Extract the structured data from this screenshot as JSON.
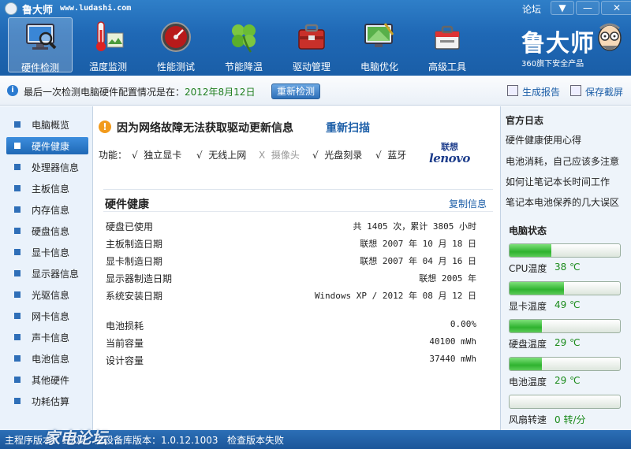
{
  "app": {
    "title": "鲁大师",
    "url": "www.ludashi.com",
    "forum": "论坛",
    "brand_name": "鲁大师",
    "brand_sub": "360旗下安全产品"
  },
  "window_controls": {
    "menu": "▼",
    "minimize": "—",
    "close": "✕"
  },
  "nav": [
    {
      "label": "硬件检测",
      "icon": "monitor-magnifier-icon",
      "active": true
    },
    {
      "label": "温度监测",
      "icon": "thermometer-icon",
      "active": false
    },
    {
      "label": "性能测试",
      "icon": "speedometer-icon",
      "active": false
    },
    {
      "label": "节能降温",
      "icon": "clover-icon",
      "active": false
    },
    {
      "label": "驱动管理",
      "icon": "toolbox-icon",
      "active": false
    },
    {
      "label": "电脑优化",
      "icon": "monitor-sweep-icon",
      "active": false
    },
    {
      "label": "高级工具",
      "icon": "toolkit-icon",
      "active": false
    }
  ],
  "infobar": {
    "text": "最后一次检测电脑硬件配置情况是在：",
    "date": "2012年8月12日",
    "rescan": "重新检测",
    "report": "生成报告",
    "screenshot": "保存截屏"
  },
  "sidebar": [
    {
      "label": "电脑概览",
      "active": false
    },
    {
      "label": "硬件健康",
      "active": true
    },
    {
      "label": "处理器信息",
      "active": false
    },
    {
      "label": "主板信息",
      "active": false
    },
    {
      "label": "内存信息",
      "active": false
    },
    {
      "label": "硬盘信息",
      "active": false
    },
    {
      "label": "显卡信息",
      "active": false
    },
    {
      "label": "显示器信息",
      "active": false
    },
    {
      "label": "光驱信息",
      "active": false
    },
    {
      "label": "网卡信息",
      "active": false
    },
    {
      "label": "声卡信息",
      "active": false
    },
    {
      "label": "电池信息",
      "active": false
    },
    {
      "label": "其他硬件",
      "active": false
    },
    {
      "label": "功耗估算",
      "active": false
    }
  ],
  "main": {
    "warning": "因为网络故障无法获取驱动更新信息",
    "rescan_link": "重新扫描",
    "features_label": "功能：",
    "features": [
      {
        "mark": "√",
        "label": "独立显卡",
        "available": true
      },
      {
        "mark": "√",
        "label": "无线上网",
        "available": true
      },
      {
        "mark": "X",
        "label": "摄像头",
        "available": false
      },
      {
        "mark": "√",
        "label": "光盘刻录",
        "available": true
      },
      {
        "mark": "√",
        "label": "蓝牙",
        "available": true
      }
    ],
    "vendor_cn": "联想",
    "vendor_en": "lenovo",
    "section_title": "硬件健康",
    "copy_link": "复制信息",
    "rows": [
      {
        "label": "硬盘已使用",
        "value": "共 1405 次，累计 3805 小时"
      },
      {
        "label": "主板制造日期",
        "value": "联想 2007 年 10 月 18 日"
      },
      {
        "label": "显卡制造日期",
        "value": "联想 2007 年 04 月 16 日"
      },
      {
        "label": "显示器制造日期",
        "value": "联想 2005 年"
      },
      {
        "label": "系统安装日期",
        "value": "Windows XP / 2012 年 08 月 12 日"
      }
    ],
    "battery_rows": [
      {
        "label": "电池损耗",
        "value": "0.00%"
      },
      {
        "label": "当前容量",
        "value": "40100 mWh"
      },
      {
        "label": "设计容量",
        "value": "37440 mWh"
      }
    ]
  },
  "right_panel": {
    "blog_title": "官方日志",
    "blog_links": [
      "硬件健康使用心得",
      "电池消耗，自己应该多注意",
      "如何让笔记本长时间工作",
      "笔记本电池保养的几大误区"
    ],
    "status_title": "电脑状态",
    "meters": [
      {
        "label": "CPU温度",
        "value": "38 ℃",
        "level": 0.38
      },
      {
        "label": "显卡温度",
        "value": "49 ℃",
        "level": 0.49
      },
      {
        "label": "硬盘温度",
        "value": "29 ℃",
        "level": 0.29
      },
      {
        "label": "电池温度",
        "value": "29 ℃",
        "level": 0.29
      },
      {
        "label": "风扇转速",
        "value": "0 转/分",
        "level": 0.0
      }
    ]
  },
  "statusbar": {
    "text": "主程序版本：1005   主设备库版本：1.0.12.1003   检查版本失败",
    "watermark": "家电论坛"
  }
}
